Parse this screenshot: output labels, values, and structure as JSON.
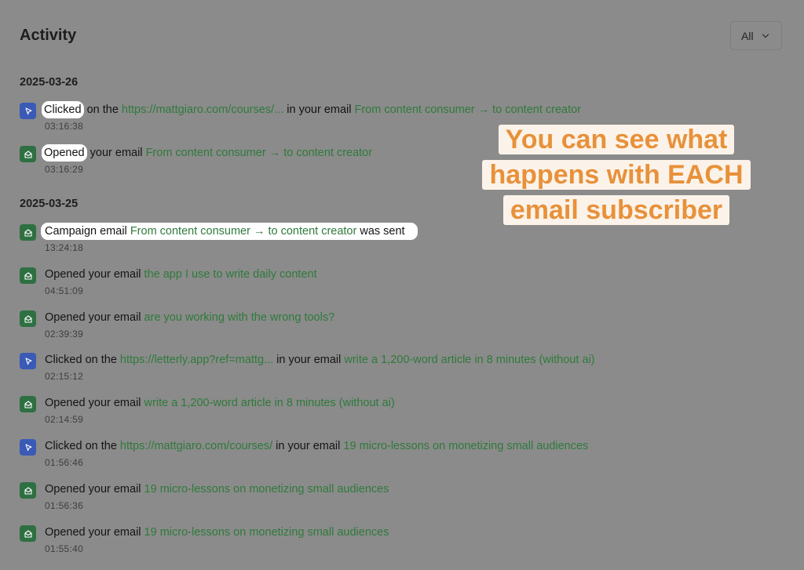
{
  "header": {
    "title": "Activity",
    "filter_value": "All"
  },
  "groups": [
    {
      "date": "2025-03-26",
      "events": [
        {
          "type": "click",
          "word": "Clicked",
          "p1": " on the ",
          "link": "https://mattgiaro.com/courses/...",
          "p2": " in your email ",
          "subject": "From content consumer → to content creator",
          "time": "03:16:38"
        },
        {
          "type": "open",
          "word": "Opened",
          "p1": " your email ",
          "subject": "From content consumer → to content creator",
          "time": "03:16:29"
        }
      ]
    },
    {
      "date": "2025-03-25",
      "events": [
        {
          "type": "open",
          "pre": "Campaign email ",
          "subject": "From content consumer → to content creator",
          "post": " was sent",
          "time": "13:24:18"
        },
        {
          "type": "open",
          "pre": "Opened your email ",
          "subject": "the app I use to write daily content",
          "time": "04:51:09"
        },
        {
          "type": "open",
          "pre": "Opened your email ",
          "subject": "are you working with the wrong tools?",
          "time": "02:39:39"
        },
        {
          "type": "click",
          "pre": "Clicked on the ",
          "link": "https://letterly.app?ref=mattg...",
          "mid": " in your email ",
          "subject": "write a 1,200-word article in 8 minutes (without ai)",
          "time": "02:15:12"
        },
        {
          "type": "open",
          "pre": "Opened your email ",
          "subject": "write a 1,200-word article in 8 minutes (without ai)",
          "time": "02:14:59"
        },
        {
          "type": "click",
          "pre": "Clicked on the ",
          "link": "https://mattgiaro.com/courses/",
          "mid": " in your email ",
          "subject": "19 micro-lessons on monetizing small audiences",
          "time": "01:56:46"
        },
        {
          "type": "open",
          "pre": "Opened your email ",
          "subject": "19 micro-lessons on monetizing small audiences",
          "time": "01:56:36"
        },
        {
          "type": "open",
          "pre": "Opened your email ",
          "subject": "19 micro-lessons on monetizing small audiences",
          "time": "01:55:40"
        }
      ]
    }
  ],
  "callout": {
    "line1": "You can see what",
    "line2": "happens with EACH",
    "line3": "email subscriber"
  },
  "colors": {
    "background": "#8b8b8b",
    "link_green": "#2f7a3b",
    "open_icon": "#2e7042",
    "click_icon": "#3a5ab6",
    "callout_text": "#e8913a",
    "callout_bg": "#fbf3ea"
  },
  "icons": {
    "open": "envelope-open-icon",
    "click": "cursor-click-icon"
  }
}
